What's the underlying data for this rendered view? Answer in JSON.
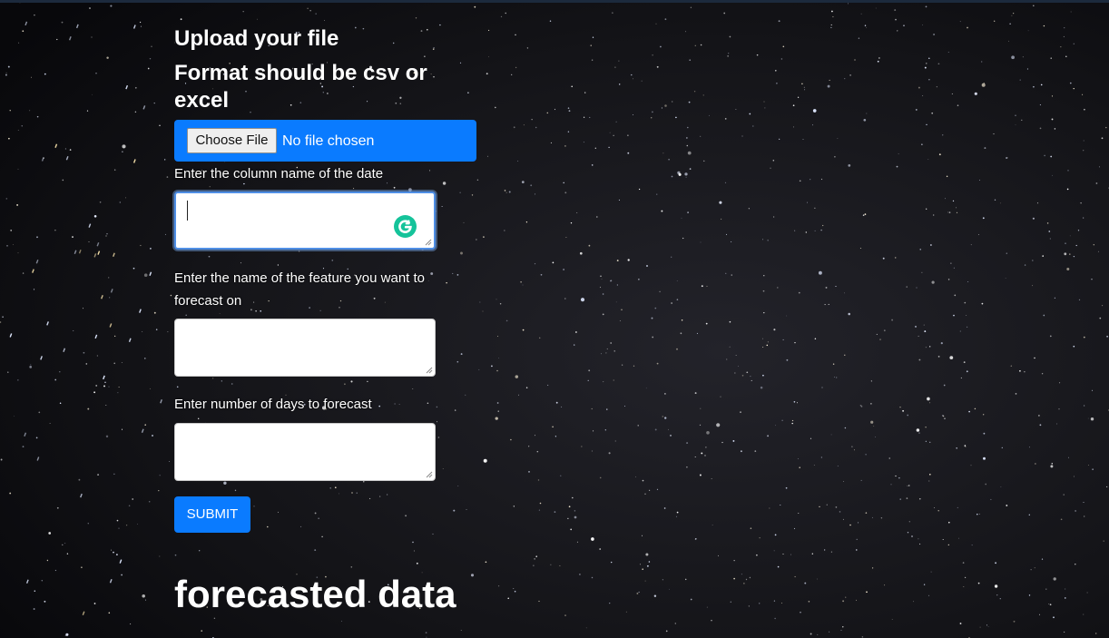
{
  "page": {
    "upload_heading": "Upload your file",
    "format_heading": "Format should be csv or excel",
    "results_heading": "forecasted data"
  },
  "file_upload": {
    "button_label": "Choose File",
    "status_text": "No file chosen"
  },
  "fields": [
    {
      "label": "Enter the column name of the date",
      "value": ""
    },
    {
      "label": "Enter the name of the feature you want to forecast on",
      "value": ""
    },
    {
      "label": "Enter number of days to forecast",
      "value": ""
    }
  ],
  "submit": {
    "label": "SUBMIT"
  },
  "icons": {
    "grammarly": "grammarly-icon",
    "resize": "resize-handle-icon"
  },
  "colors": {
    "accent": "#0a7bff",
    "background": "#0c0c10",
    "grammarly": "#15c39a",
    "focus_ring": "#4f8fe6"
  }
}
